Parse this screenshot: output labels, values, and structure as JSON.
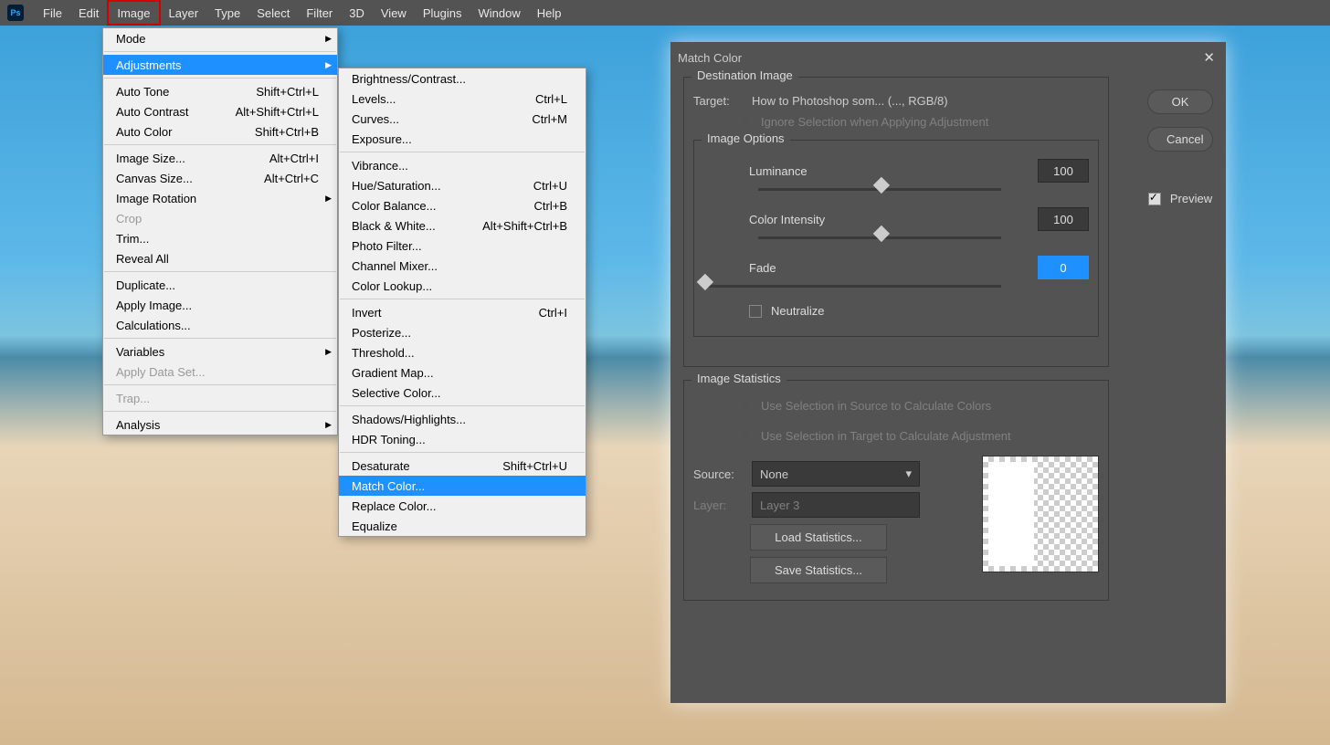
{
  "menubar": [
    "File",
    "Edit",
    "Image",
    "Layer",
    "Type",
    "Select",
    "Filter",
    "3D",
    "View",
    "Plugins",
    "Window",
    "Help"
  ],
  "ps": "Ps",
  "menu1": {
    "mode": "Mode",
    "adj": "Adjustments",
    "autoTone": "Auto Tone",
    "autoToneK": "Shift+Ctrl+L",
    "autoCon": "Auto Contrast",
    "autoConK": "Alt+Shift+Ctrl+L",
    "autoCol": "Auto Color",
    "autoColK": "Shift+Ctrl+B",
    "imgSize": "Image Size...",
    "imgSizeK": "Alt+Ctrl+I",
    "canSize": "Canvas Size...",
    "canSizeK": "Alt+Ctrl+C",
    "imgRot": "Image Rotation",
    "crop": "Crop",
    "trim": "Trim...",
    "reveal": "Reveal All",
    "dup": "Duplicate...",
    "apply": "Apply Image...",
    "calc": "Calculations...",
    "vars": "Variables",
    "applyData": "Apply Data Set...",
    "trap": "Trap...",
    "analysis": "Analysis"
  },
  "menu2": {
    "bc": "Brightness/Contrast...",
    "lvl": "Levels...",
    "lvlK": "Ctrl+L",
    "crv": "Curves...",
    "crvK": "Ctrl+M",
    "exp": "Exposure...",
    "vib": "Vibrance...",
    "hue": "Hue/Saturation...",
    "hueK": "Ctrl+U",
    "cb": "Color Balance...",
    "cbK": "Ctrl+B",
    "bw": "Black & White...",
    "bwK": "Alt+Shift+Ctrl+B",
    "pf": "Photo Filter...",
    "cm": "Channel Mixer...",
    "cl": "Color Lookup...",
    "inv": "Invert",
    "invK": "Ctrl+I",
    "post": "Posterize...",
    "thr": "Threshold...",
    "gm": "Gradient Map...",
    "sc": "Selective Color...",
    "sh": "Shadows/Highlights...",
    "hdr": "HDR Toning...",
    "des": "Desaturate",
    "desK": "Shift+Ctrl+U",
    "match": "Match Color...",
    "rep": "Replace Color...",
    "eq": "Equalize"
  },
  "dlg": {
    "title": "Match Color",
    "dest": "Destination Image",
    "target": "Target:",
    "targetVal": "How to Photoshop som... (..., RGB/8)",
    "ignore": "Ignore Selection when Applying Adjustment",
    "opts": "Image Options",
    "lum": "Luminance",
    "lumV": "100",
    "ci": "Color Intensity",
    "ciV": "100",
    "fade": "Fade",
    "fadeV": "0",
    "neut": "Neutralize",
    "stats": "Image Statistics",
    "useSrc": "Use Selection in Source to Calculate Colors",
    "useTgt": "Use Selection in Target to Calculate Adjustment",
    "src": "Source:",
    "srcV": "None",
    "layer": "Layer:",
    "layerV": "Layer 3",
    "load": "Load Statistics...",
    "save": "Save Statistics...",
    "ok": "OK",
    "cancel": "Cancel",
    "preview": "Preview"
  }
}
